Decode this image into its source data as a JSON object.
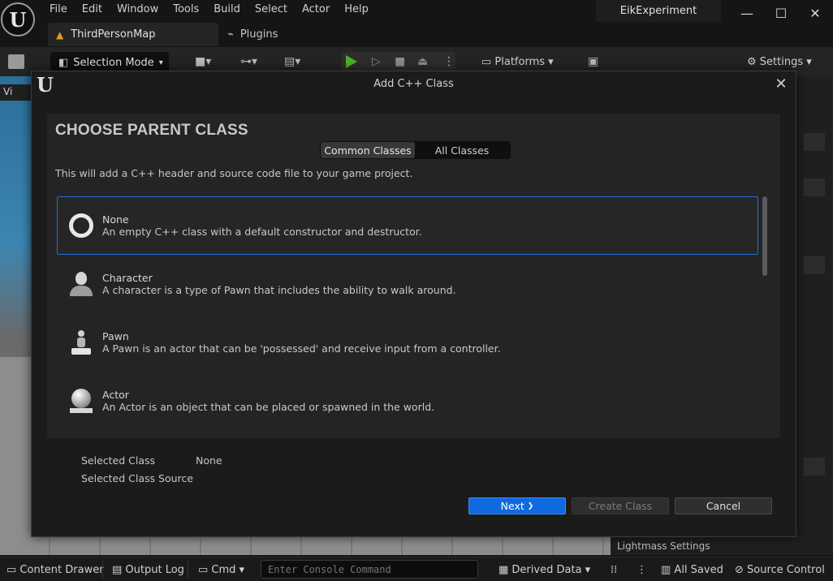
{
  "app": {
    "menu": [
      "File",
      "Edit",
      "Window",
      "Tools",
      "Build",
      "Select",
      "Actor",
      "Help"
    ],
    "project_name": "EikExperiment",
    "tabs": [
      {
        "label": "ThirdPersonMap"
      },
      {
        "label": "Plugins"
      }
    ],
    "window_controls": {
      "minimize": "—",
      "maximize": "☐",
      "close": "✕"
    }
  },
  "toolbar": {
    "selection_mode": "Selection Mode",
    "platforms": "Platforms",
    "settings": "Settings"
  },
  "viewport": {
    "tab_label": "Vi"
  },
  "right_panel": {
    "lightmass": "Lightmass Settings"
  },
  "status_bar": {
    "content_drawer": "Content Drawer",
    "output_log": "Output Log",
    "cmd": "Cmd",
    "console_placeholder": "Enter Console Command",
    "derived_data": "Derived Data",
    "all_saved": "All Saved",
    "source_control": "Source Control"
  },
  "dialog": {
    "title": "Add C++ Class",
    "heading": "CHOOSE PARENT CLASS",
    "tabs": {
      "common": "Common Classes",
      "all": "All Classes"
    },
    "description": "This will add a C++ header and source code file to your game project.",
    "classes": [
      {
        "name": "None",
        "desc": "An empty C++ class with a default constructor and destructor.",
        "icon": "none-ring-icon",
        "selected": true
      },
      {
        "name": "Character",
        "desc": "A character is a type of Pawn that includes the ability to walk around.",
        "icon": "character-icon",
        "selected": false
      },
      {
        "name": "Pawn",
        "desc": "A Pawn is an actor that can be 'possessed' and receive input from a controller.",
        "icon": "pawn-icon",
        "selected": false
      },
      {
        "name": "Actor",
        "desc": "An Actor is an object that can be placed or spawned in the world.",
        "icon": "actor-icon",
        "selected": false
      }
    ],
    "selected_class_label": "Selected Class",
    "selected_class_value": "None",
    "selected_source_label": "Selected Class Source",
    "buttons": {
      "next": "Next",
      "next_chevron": "❯",
      "create": "Create Class",
      "cancel": "Cancel"
    }
  },
  "colors": {
    "accent": "#0f6ae0",
    "selection_border": "#1f6fd8",
    "play_green": "#4caf2a",
    "map_orange": "#e69c1f"
  }
}
